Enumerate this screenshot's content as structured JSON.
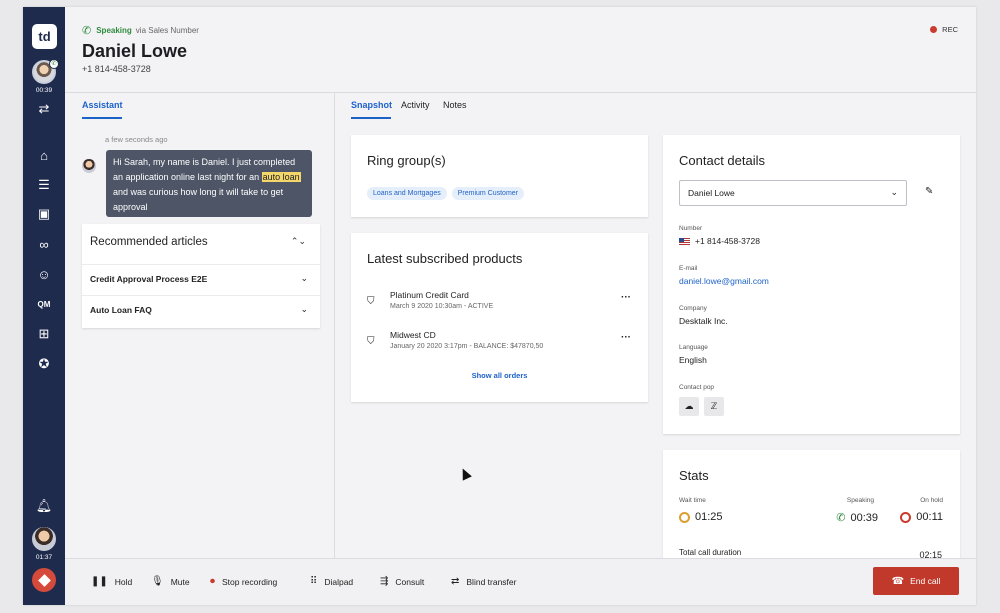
{
  "call": {
    "status": "Speaking",
    "via": "via Sales Number",
    "caller_name": "Daniel Lowe",
    "caller_number": "+1 814-458-3728",
    "rec_label": "REC"
  },
  "rail": {
    "logo": "td",
    "call_timer": "00:39",
    "qm_label": "QM",
    "agent_timer": "01:37",
    "icons": [
      "home-icon",
      "list-icon",
      "contacts-icon",
      "voicemail-icon",
      "emoji-icon",
      "qm-icon",
      "gift-icon",
      "star-icon",
      "bell-icon"
    ]
  },
  "assistant": {
    "tab_label": "Assistant",
    "time_ago": "a few seconds ago",
    "message_part1": "Hi Sarah, my name is Daniel. I just completed an application online last night for an ",
    "message_highlight": "auto loan",
    "message_part2": " and was curious how long it will take to get approval",
    "articles_title": "Recommended articles",
    "articles": [
      "Credit Approval Process E2E",
      "Auto Loan FAQ"
    ]
  },
  "main": {
    "tabs": [
      "Snapshot",
      "Activity",
      "Notes"
    ],
    "active_tab": "Snapshot"
  },
  "ring_group": {
    "title": "Ring group(s)",
    "chips": [
      "Loans and Mortgages",
      "Premium Customer"
    ]
  },
  "products": {
    "title": "Latest subscribed products",
    "items": [
      {
        "name": "Platinum Credit Card",
        "meta": "March 9 2020 10:30am - ACTIVE"
      },
      {
        "name": "Midwest CD",
        "meta": "January 20 2020 3:17pm - BALANCE: $47870,50"
      }
    ],
    "show_all": "Show all orders"
  },
  "contact": {
    "title": "Contact details",
    "selected_contact": "Daniel Lowe",
    "number_label": "Number",
    "number": "+1 814-458-3728",
    "email_label": "E-mail",
    "email": "daniel.lowe@gmail.com",
    "company_label": "Company",
    "company": "Desktalk Inc.",
    "language_label": "Language",
    "language": "English",
    "contact_pop_label": "Contact pop"
  },
  "stats": {
    "title": "Stats",
    "wait_label": "Wait time",
    "wait_value": "01:25",
    "speaking_label": "Speaking",
    "speaking_value": "00:39",
    "hold_label": "On hold",
    "hold_value": "00:11",
    "total_label": "Total call duration",
    "total_value": "02:15"
  },
  "controls": {
    "hold": "Hold",
    "mute": "Mute",
    "stop_recording": "Stop recording",
    "dialpad": "Dialpad",
    "consult": "Consult",
    "blind_transfer": "Blind transfer",
    "end_call": "End call"
  },
  "colors": {
    "rail": "#1f2b4d",
    "accent": "#1d62c9",
    "speaking_green": "#2e8b3e",
    "end_call_red": "#c0392b",
    "highlight": "#f4d76b"
  }
}
